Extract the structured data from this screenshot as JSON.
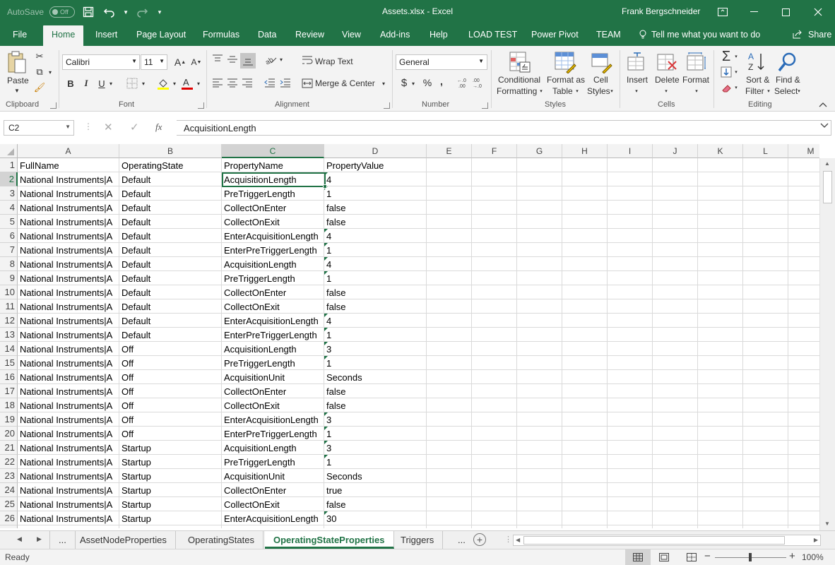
{
  "window": {
    "autosave_label": "AutoSave",
    "autosave_state": "Off",
    "title": "Assets.xlsx  -  Excel",
    "user": "Frank Bergschneider"
  },
  "ribbon_tabs": [
    "File",
    "Home",
    "Insert",
    "Page Layout",
    "Formulas",
    "Data",
    "Review",
    "View",
    "Add-ins",
    "Help",
    "LOAD TEST",
    "Power Pivot",
    "TEAM"
  ],
  "tell_me": "Tell me what you want to do",
  "share": "Share",
  "ribbon": {
    "clipboard": {
      "paste": "Paste",
      "label": "Clipboard"
    },
    "font": {
      "name": "Calibri",
      "size": "11",
      "bold": "B",
      "italic": "I",
      "underline": "U",
      "label": "Font"
    },
    "alignment": {
      "wrap": "Wrap Text",
      "merge": "Merge & Center",
      "label": "Alignment"
    },
    "number": {
      "format": "General",
      "currency": "$",
      "percent": "%",
      "comma": ",",
      "label": "Number"
    },
    "styles": {
      "conditional_1": "Conditional",
      "conditional_2": "Formatting",
      "format_table_1": "Format as",
      "format_table_2": "Table",
      "cell_styles_1": "Cell",
      "cell_styles_2": "Styles",
      "label": "Styles"
    },
    "cells": {
      "insert": "Insert",
      "delete": "Delete",
      "format": "Format",
      "label": "Cells"
    },
    "editing": {
      "sort_1": "Sort &",
      "sort_2": "Filter",
      "find_1": "Find &",
      "find_2": "Select",
      "label": "Editing"
    }
  },
  "formula_bar": {
    "name_box": "C2",
    "fx": "fx",
    "content": "AcquisitionLength"
  },
  "columns": [
    "A",
    "B",
    "C",
    "D",
    "E",
    "F",
    "G",
    "H",
    "I",
    "J",
    "K",
    "L",
    "M"
  ],
  "rows": [
    [
      "FullName",
      "OperatingState",
      "PropertyName",
      "PropertyValue"
    ],
    [
      "National Instruments|A",
      "Default",
      "AcquisitionLength",
      "4"
    ],
    [
      "National Instruments|A",
      "Default",
      "PreTriggerLength",
      "1"
    ],
    [
      "National Instruments|A",
      "Default",
      "CollectOnEnter",
      "false"
    ],
    [
      "National Instruments|A",
      "Default",
      "CollectOnExit",
      "false"
    ],
    [
      "National Instruments|A",
      "Default",
      "EnterAcquisitionLength",
      "4"
    ],
    [
      "National Instruments|A",
      "Default",
      "EnterPreTriggerLength",
      "1"
    ],
    [
      "National Instruments|A",
      "Default",
      "AcquisitionLength",
      "4"
    ],
    [
      "National Instruments|A",
      "Default",
      "PreTriggerLength",
      "1"
    ],
    [
      "National Instruments|A",
      "Default",
      "CollectOnEnter",
      "false"
    ],
    [
      "National Instruments|A",
      "Default",
      "CollectOnExit",
      "false"
    ],
    [
      "National Instruments|A",
      "Default",
      "EnterAcquisitionLength",
      "4"
    ],
    [
      "National Instruments|A",
      "Default",
      "EnterPreTriggerLength",
      "1"
    ],
    [
      "National Instruments|A",
      "Off",
      "AcquisitionLength",
      "3"
    ],
    [
      "National Instruments|A",
      "Off",
      "PreTriggerLength",
      "1"
    ],
    [
      "National Instruments|A",
      "Off",
      "AcquisitionUnit",
      "Seconds"
    ],
    [
      "National Instruments|A",
      "Off",
      "CollectOnEnter",
      "false"
    ],
    [
      "National Instruments|A",
      "Off",
      "CollectOnExit",
      "false"
    ],
    [
      "National Instruments|A",
      "Off",
      "EnterAcquisitionLength",
      "3"
    ],
    [
      "National Instruments|A",
      "Off",
      "EnterPreTriggerLength",
      "1"
    ],
    [
      "National Instruments|A",
      "Startup",
      "AcquisitionLength",
      "3"
    ],
    [
      "National Instruments|A",
      "Startup",
      "PreTriggerLength",
      "1"
    ],
    [
      "National Instruments|A",
      "Startup",
      "AcquisitionUnit",
      "Seconds"
    ],
    [
      "National Instruments|A",
      "Startup",
      "CollectOnEnter",
      "true"
    ],
    [
      "National Instruments|A",
      "Startup",
      "CollectOnExit",
      "false"
    ],
    [
      "National Instruments|A",
      "Startup",
      "EnterAcquisitionLength",
      "30"
    ]
  ],
  "sheet_tabs": [
    "AssetNodeProperties",
    "OperatingStates",
    "OperatingStateProperties",
    "Triggers"
  ],
  "sheet_nav": {
    "more": "..."
  },
  "status": {
    "ready": "Ready",
    "zoom": "100%"
  },
  "colors": {
    "accent": "#217346",
    "ribbon_bg": "#f3f3f3"
  }
}
